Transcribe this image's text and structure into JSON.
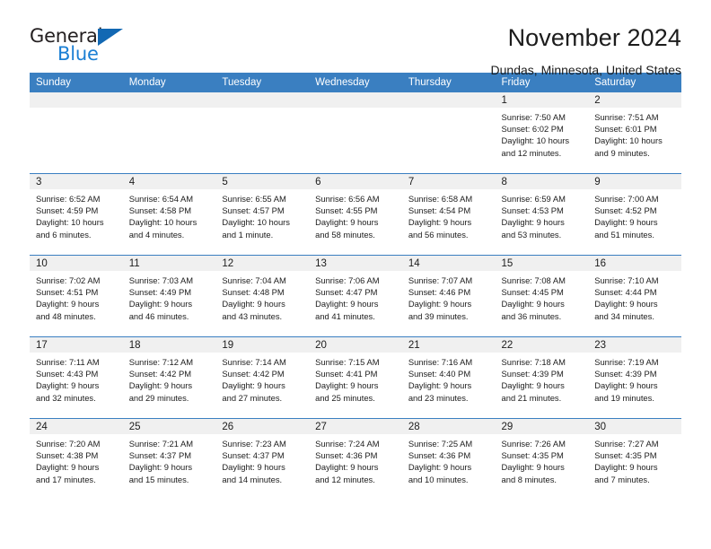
{
  "brand": {
    "name_part1": "General",
    "name_part2": "Blue",
    "accent_color": "#1b7fd4",
    "triangle_color": "#1268b3"
  },
  "header": {
    "title": "November 2024",
    "subtitle": "Dundas, Minnesota, United States",
    "header_bg_color": "#3a7fc1"
  },
  "weekday_headers": [
    "Sunday",
    "Monday",
    "Tuesday",
    "Wednesday",
    "Thursday",
    "Friday",
    "Saturday"
  ],
  "labels": {
    "sunrise_prefix": "Sunrise:",
    "sunset_prefix": "Sunset:",
    "daylight_prefix": "Daylight:"
  },
  "weeks": [
    [
      {
        "empty": true,
        "day": ""
      },
      {
        "empty": true,
        "day": ""
      },
      {
        "empty": true,
        "day": ""
      },
      {
        "empty": true,
        "day": ""
      },
      {
        "empty": true,
        "day": ""
      },
      {
        "empty": false,
        "day": "1",
        "sunrise": "Sunrise: 7:50 AM",
        "sunset": "Sunset: 6:02 PM",
        "daylight_line1": "Daylight: 10 hours",
        "daylight_line2": "and 12 minutes."
      },
      {
        "empty": false,
        "day": "2",
        "sunrise": "Sunrise: 7:51 AM",
        "sunset": "Sunset: 6:01 PM",
        "daylight_line1": "Daylight: 10 hours",
        "daylight_line2": "and 9 minutes."
      }
    ],
    [
      {
        "empty": false,
        "day": "3",
        "sunrise": "Sunrise: 6:52 AM",
        "sunset": "Sunset: 4:59 PM",
        "daylight_line1": "Daylight: 10 hours",
        "daylight_line2": "and 6 minutes."
      },
      {
        "empty": false,
        "day": "4",
        "sunrise": "Sunrise: 6:54 AM",
        "sunset": "Sunset: 4:58 PM",
        "daylight_line1": "Daylight: 10 hours",
        "daylight_line2": "and 4 minutes."
      },
      {
        "empty": false,
        "day": "5",
        "sunrise": "Sunrise: 6:55 AM",
        "sunset": "Sunset: 4:57 PM",
        "daylight_line1": "Daylight: 10 hours",
        "daylight_line2": "and 1 minute."
      },
      {
        "empty": false,
        "day": "6",
        "sunrise": "Sunrise: 6:56 AM",
        "sunset": "Sunset: 4:55 PM",
        "daylight_line1": "Daylight: 9 hours",
        "daylight_line2": "and 58 minutes."
      },
      {
        "empty": false,
        "day": "7",
        "sunrise": "Sunrise: 6:58 AM",
        "sunset": "Sunset: 4:54 PM",
        "daylight_line1": "Daylight: 9 hours",
        "daylight_line2": "and 56 minutes."
      },
      {
        "empty": false,
        "day": "8",
        "sunrise": "Sunrise: 6:59 AM",
        "sunset": "Sunset: 4:53 PM",
        "daylight_line1": "Daylight: 9 hours",
        "daylight_line2": "and 53 minutes."
      },
      {
        "empty": false,
        "day": "9",
        "sunrise": "Sunrise: 7:00 AM",
        "sunset": "Sunset: 4:52 PM",
        "daylight_line1": "Daylight: 9 hours",
        "daylight_line2": "and 51 minutes."
      }
    ],
    [
      {
        "empty": false,
        "day": "10",
        "sunrise": "Sunrise: 7:02 AM",
        "sunset": "Sunset: 4:51 PM",
        "daylight_line1": "Daylight: 9 hours",
        "daylight_line2": "and 48 minutes."
      },
      {
        "empty": false,
        "day": "11",
        "sunrise": "Sunrise: 7:03 AM",
        "sunset": "Sunset: 4:49 PM",
        "daylight_line1": "Daylight: 9 hours",
        "daylight_line2": "and 46 minutes."
      },
      {
        "empty": false,
        "day": "12",
        "sunrise": "Sunrise: 7:04 AM",
        "sunset": "Sunset: 4:48 PM",
        "daylight_line1": "Daylight: 9 hours",
        "daylight_line2": "and 43 minutes."
      },
      {
        "empty": false,
        "day": "13",
        "sunrise": "Sunrise: 7:06 AM",
        "sunset": "Sunset: 4:47 PM",
        "daylight_line1": "Daylight: 9 hours",
        "daylight_line2": "and 41 minutes."
      },
      {
        "empty": false,
        "day": "14",
        "sunrise": "Sunrise: 7:07 AM",
        "sunset": "Sunset: 4:46 PM",
        "daylight_line1": "Daylight: 9 hours",
        "daylight_line2": "and 39 minutes."
      },
      {
        "empty": false,
        "day": "15",
        "sunrise": "Sunrise: 7:08 AM",
        "sunset": "Sunset: 4:45 PM",
        "daylight_line1": "Daylight: 9 hours",
        "daylight_line2": "and 36 minutes."
      },
      {
        "empty": false,
        "day": "16",
        "sunrise": "Sunrise: 7:10 AM",
        "sunset": "Sunset: 4:44 PM",
        "daylight_line1": "Daylight: 9 hours",
        "daylight_line2": "and 34 minutes."
      }
    ],
    [
      {
        "empty": false,
        "day": "17",
        "sunrise": "Sunrise: 7:11 AM",
        "sunset": "Sunset: 4:43 PM",
        "daylight_line1": "Daylight: 9 hours",
        "daylight_line2": "and 32 minutes."
      },
      {
        "empty": false,
        "day": "18",
        "sunrise": "Sunrise: 7:12 AM",
        "sunset": "Sunset: 4:42 PM",
        "daylight_line1": "Daylight: 9 hours",
        "daylight_line2": "and 29 minutes."
      },
      {
        "empty": false,
        "day": "19",
        "sunrise": "Sunrise: 7:14 AM",
        "sunset": "Sunset: 4:42 PM",
        "daylight_line1": "Daylight: 9 hours",
        "daylight_line2": "and 27 minutes."
      },
      {
        "empty": false,
        "day": "20",
        "sunrise": "Sunrise: 7:15 AM",
        "sunset": "Sunset: 4:41 PM",
        "daylight_line1": "Daylight: 9 hours",
        "daylight_line2": "and 25 minutes."
      },
      {
        "empty": false,
        "day": "21",
        "sunrise": "Sunrise: 7:16 AM",
        "sunset": "Sunset: 4:40 PM",
        "daylight_line1": "Daylight: 9 hours",
        "daylight_line2": "and 23 minutes."
      },
      {
        "empty": false,
        "day": "22",
        "sunrise": "Sunrise: 7:18 AM",
        "sunset": "Sunset: 4:39 PM",
        "daylight_line1": "Daylight: 9 hours",
        "daylight_line2": "and 21 minutes."
      },
      {
        "empty": false,
        "day": "23",
        "sunrise": "Sunrise: 7:19 AM",
        "sunset": "Sunset: 4:39 PM",
        "daylight_line1": "Daylight: 9 hours",
        "daylight_line2": "and 19 minutes."
      }
    ],
    [
      {
        "empty": false,
        "day": "24",
        "sunrise": "Sunrise: 7:20 AM",
        "sunset": "Sunset: 4:38 PM",
        "daylight_line1": "Daylight: 9 hours",
        "daylight_line2": "and 17 minutes."
      },
      {
        "empty": false,
        "day": "25",
        "sunrise": "Sunrise: 7:21 AM",
        "sunset": "Sunset: 4:37 PM",
        "daylight_line1": "Daylight: 9 hours",
        "daylight_line2": "and 15 minutes."
      },
      {
        "empty": false,
        "day": "26",
        "sunrise": "Sunrise: 7:23 AM",
        "sunset": "Sunset: 4:37 PM",
        "daylight_line1": "Daylight: 9 hours",
        "daylight_line2": "and 14 minutes."
      },
      {
        "empty": false,
        "day": "27",
        "sunrise": "Sunrise: 7:24 AM",
        "sunset": "Sunset: 4:36 PM",
        "daylight_line1": "Daylight: 9 hours",
        "daylight_line2": "and 12 minutes."
      },
      {
        "empty": false,
        "day": "28",
        "sunrise": "Sunrise: 7:25 AM",
        "sunset": "Sunset: 4:36 PM",
        "daylight_line1": "Daylight: 9 hours",
        "daylight_line2": "and 10 minutes."
      },
      {
        "empty": false,
        "day": "29",
        "sunrise": "Sunrise: 7:26 AM",
        "sunset": "Sunset: 4:35 PM",
        "daylight_line1": "Daylight: 9 hours",
        "daylight_line2": "and 8 minutes."
      },
      {
        "empty": false,
        "day": "30",
        "sunrise": "Sunrise: 7:27 AM",
        "sunset": "Sunset: 4:35 PM",
        "daylight_line1": "Daylight: 9 hours",
        "daylight_line2": "and 7 minutes."
      }
    ]
  ]
}
